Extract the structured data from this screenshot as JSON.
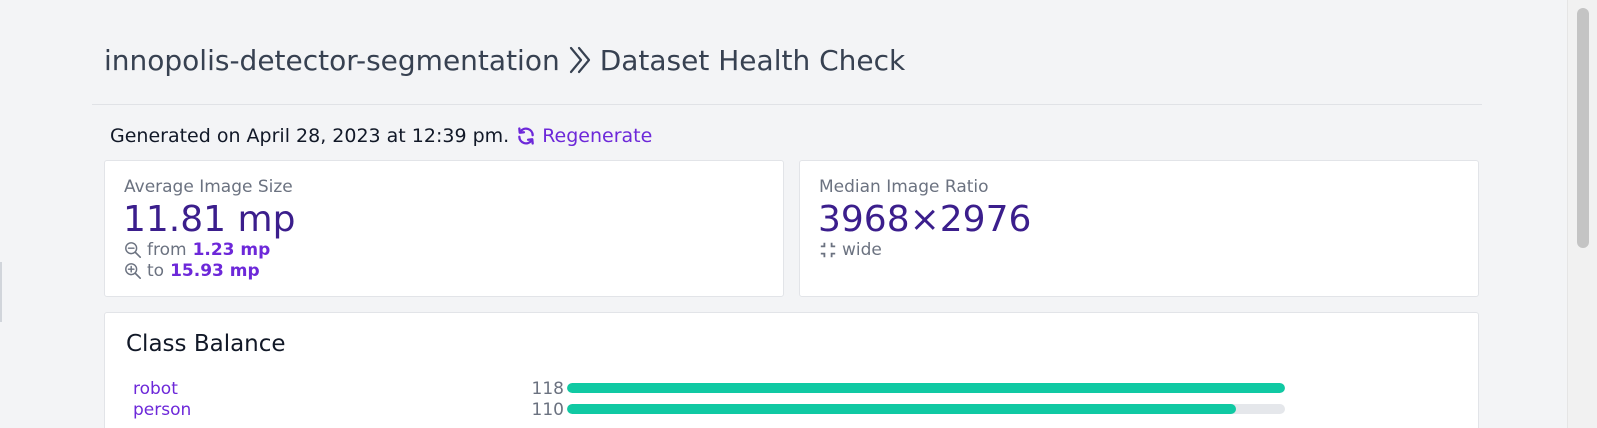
{
  "header": {
    "project": "innopolis-detector-segmentation",
    "page_title": "Dataset Health Check"
  },
  "generated": {
    "text": "Generated on April 28, 2023 at 12:39 pm.",
    "regenerate_label": "Regenerate"
  },
  "avg_image_size": {
    "label": "Average Image Size",
    "value": "11.81 mp",
    "from_label": "from",
    "from_value": "1.23 mp",
    "to_label": "to",
    "to_value": "15.93 mp"
  },
  "median_ratio": {
    "label": "Median Image Ratio",
    "value": "3968×2976",
    "shape": "wide"
  },
  "class_balance": {
    "title": "Class Balance",
    "classes": [
      {
        "name": "robot",
        "count": 118,
        "fraction": 1.0
      },
      {
        "name": "person",
        "count": 110,
        "fraction": 0.932
      }
    ]
  },
  "colors": {
    "accent": "#6d28d9",
    "value_text": "#3b1e8c",
    "bar_fill": "#10c9a3",
    "bar_track": "#e5e7eb"
  },
  "icons": {
    "separator": "chevron-double-right-icon",
    "regenerate": "refresh-icon",
    "from": "zoom-out-icon",
    "to": "zoom-in-icon",
    "shape": "compress-icon"
  }
}
